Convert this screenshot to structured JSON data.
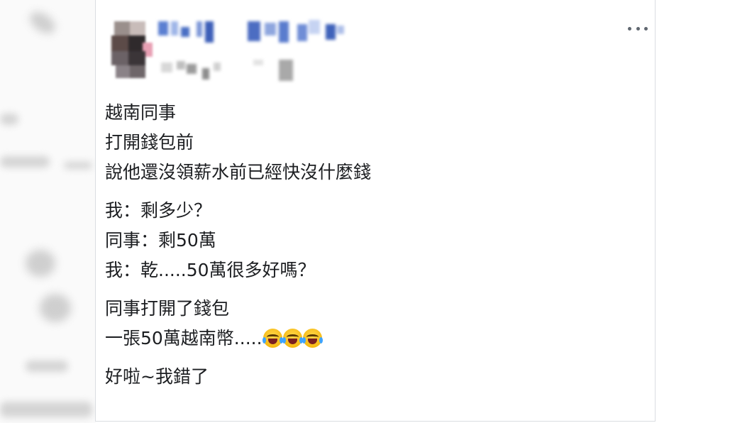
{
  "post": {
    "paragraphs": [
      {
        "lines": [
          "越南同事",
          "打開錢包前",
          "說他還沒領薪水前已經快沒什麼錢"
        ]
      },
      {
        "lines": [
          "我：剩多少？",
          "同事：剩50萬",
          "我：乾.....50萬很多好嗎？"
        ]
      },
      {
        "lines": [
          "同事打開了錢包",
          "一張50萬越南幣....."
        ],
        "trailing_emoji": [
          "tears-of-joy-icon",
          "tears-of-joy-icon",
          "tears-of-joy-icon"
        ]
      },
      {
        "lines": [
          "好啦~我錯了"
        ]
      }
    ],
    "more_icon": "more-options-icon"
  },
  "colors": {
    "text": "#1c1e21",
    "card_border": "#dadde1",
    "icon_gray": "#606770"
  }
}
